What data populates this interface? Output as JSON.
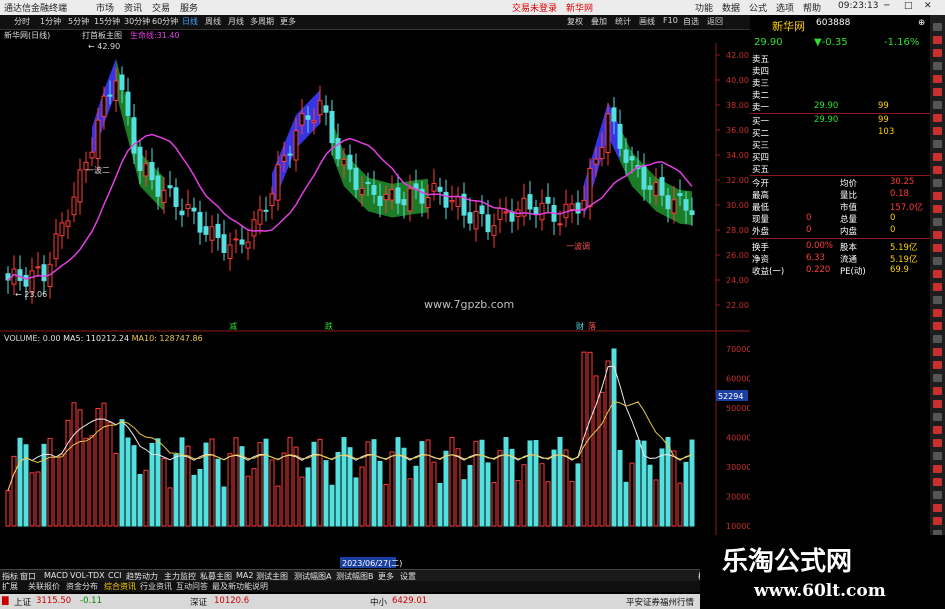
{
  "titlebar": {
    "app_title": "通达信金融终端",
    "tabs": [
      "市场",
      "资讯",
      "交易",
      "服务"
    ],
    "link1": "交易未登录",
    "link2": "新华网",
    "buttons": [
      "功能",
      "数据",
      "公式",
      "选项",
      "帮助"
    ],
    "time": "09:23:13"
  },
  "menubar": {
    "items": [
      "分时",
      "1分钟",
      "5分钟",
      "15分钟",
      "30分钟",
      "60分钟",
      "日线",
      "周线",
      "月线",
      "多周期",
      "更多"
    ],
    "right_items": [
      "复权",
      "叠加",
      "统计",
      "画线",
      "F10",
      "自选",
      "返回"
    ]
  },
  "infobar": {
    "stock": "新华网(日线)",
    "indicator": "打首板主图",
    "ma_label": "生命线:31.40"
  },
  "price_axis": [
    "42.00",
    "40.00",
    "38.00",
    "36.00",
    "34.00",
    "32.00",
    "30.00",
    "28.00",
    "26.00",
    "24.00",
    "22.00"
  ],
  "annotations": {
    "high": "42.90",
    "low": "23.06",
    "wave_label": "一波二",
    "low2": "一波调",
    "tag1": "减",
    "tag2": "跌",
    "tag3": "财",
    "tag4": "落"
  },
  "watermark_site": "www.7gpzb.com",
  "volume": {
    "label": "VOLUME: 0.00",
    "ma5": "MA5: 110212.24",
    "ma10": "MA10: 128747.86",
    "axis": [
      "70000",
      "60000",
      "50000",
      "40000",
      "30000",
      "20000",
      "10000"
    ],
    "current": "52294",
    "date": "2023/06/27(二)"
  },
  "quote": {
    "name": "新华网",
    "code": "603888",
    "price": "29.90",
    "change": "▼-0.35",
    "pct": "-1.16%",
    "sell": [
      {
        "label": "卖五",
        "price": "",
        "vol": ""
      },
      {
        "label": "卖四",
        "price": "",
        "vol": ""
      },
      {
        "label": "卖三",
        "price": "",
        "vol": ""
      },
      {
        "label": "卖二",
        "price": "",
        "vol": ""
      },
      {
        "label": "卖一",
        "price": "29.90",
        "vol": "99"
      }
    ],
    "buy": [
      {
        "label": "买一",
        "price": "29.90",
        "vol": "99"
      },
      {
        "label": "买二",
        "price": "",
        "vol": "103"
      },
      {
        "label": "买三",
        "price": "",
        "vol": ""
      },
      {
        "label": "买四",
        "price": "",
        "vol": ""
      },
      {
        "label": "买五",
        "price": "",
        "vol": ""
      }
    ],
    "stats": [
      {
        "k1": "今开",
        "v1": "",
        "k2": "均价",
        "v2": "30.25"
      },
      {
        "k1": "最高",
        "v1": "",
        "k2": "量比",
        "v2": "0.18"
      },
      {
        "k1": "最低",
        "v1": "",
        "k2": "市值",
        "v2": "157.0亿"
      },
      {
        "k1": "现量",
        "v1": "0",
        "k2": "总量",
        "v2": "0"
      },
      {
        "k1": "外盘",
        "v1": "0",
        "k2": "内盘",
        "v2": "0"
      },
      {
        "k1": "换手",
        "v1": "0.00%",
        "k2": "股本",
        "v2": "5.19亿"
      },
      {
        "k1": "净资",
        "v1": "6.33",
        "k2": "流通",
        "v2": "5.19亿"
      },
      {
        "k1": "收益(一)",
        "v1": "0.220",
        "k2": "PE(动)",
        "v2": "69.9"
      }
    ]
  },
  "bottom_tabs": [
    "指标",
    "窗口",
    "MACD",
    "VOL-TDX",
    "CCI",
    "趋势动力",
    "主力监控",
    "私募主图",
    "MA2",
    "测试主图",
    "测试幅图A",
    "测试幅图B",
    "更多",
    "设置"
  ],
  "bottom_tabs2": [
    "扩展",
    "关联报价",
    "资金分布",
    "综合资讯",
    "行业资讯",
    "互动问答",
    "最及新功能说明"
  ],
  "bottom_right": "模板",
  "status": {
    "idx1_name": "上证",
    "idx1_val": "3115.50",
    "idx1_chg": "-0.11",
    "idx2_name": "深证",
    "idx2_val": "10120.6",
    "idx3_name": "中小",
    "idx3_val": "6429.01",
    "broker": "平安证券福州行情"
  },
  "watermark": {
    "brand": "乐淘公式网",
    "url": "www.60lt.com"
  },
  "colors": {
    "bg": "#000000",
    "up": "#ff3c3c",
    "down": "#55e0e0",
    "ma": "#e040e0",
    "band_up": "#3b3bff",
    "band_down": "#1f8a2a"
  }
}
